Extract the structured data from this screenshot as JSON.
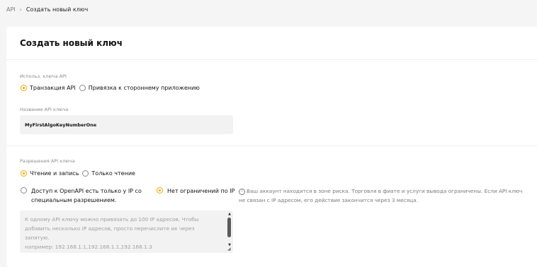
{
  "breadcrumb": {
    "root": "API",
    "separator": "›",
    "current": "Создать новый ключ"
  },
  "card": {
    "title": "Создать новый ключ",
    "usage": {
      "label": "Использ. ключа API",
      "options": [
        {
          "label": "Транзакция API",
          "checked": true
        },
        {
          "label": "Привязка к стороннему приложению",
          "checked": false
        }
      ]
    },
    "name": {
      "label": "Название API ключа",
      "value": "MyFirstAlgoKeyNumberOne"
    },
    "permissions": {
      "label": "Разрешения API ключа",
      "options": [
        {
          "label": "Чтение и запись",
          "checked": true
        },
        {
          "label": "Только чтение",
          "checked": false
        }
      ]
    },
    "ip": {
      "option_restricted": "Доступ к OpenAPI есть только у IP со специальным разрешением.",
      "option_unrestricted": "Нет ограничений по IP",
      "warning": "Ваш аккаунт находится в зоне риска. Торговля в фиате и услуги вывода ограничены. Если API ключ не связан с IP адресом, его действие закончится через 3 месяца.",
      "textarea_placeholder_lines": [
        "К одному API ключу можно привязать до 100 IP адресов. Чтобы",
        "добавить несколько IP адресов, просто перечислите их через",
        "запятую.",
        "например: 192.168.1.1,192.168.1.1,192.168.1.3"
      ]
    }
  },
  "colors": {
    "accent": "#f7a600",
    "background": "#f5f5f5",
    "input_bg": "#f2f2f3"
  }
}
